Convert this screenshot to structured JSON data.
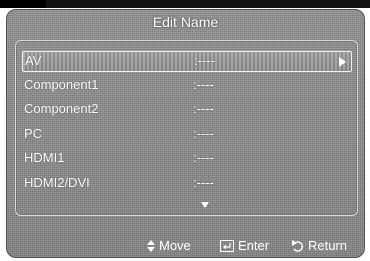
{
  "dialog": {
    "title": "Edit Name",
    "down_indicator_icon": "triangle-down"
  },
  "items": [
    {
      "label": "AV",
      "value": ":----",
      "selected": true,
      "icon": "triangle-right"
    },
    {
      "label": "Component1",
      "value": ":----"
    },
    {
      "label": "Component2",
      "value": ":----"
    },
    {
      "label": "PC",
      "value": ":----"
    },
    {
      "label": "HDMI1",
      "value": ":----"
    },
    {
      "label": "HDMI2/DVI",
      "value": ":----"
    }
  ],
  "footer": {
    "move_label": "Move",
    "move_icon": "up-down-arrows",
    "enter_label": "Enter",
    "enter_icon": "enter-key",
    "return_label": "Return",
    "return_icon": "return-arrow"
  }
}
